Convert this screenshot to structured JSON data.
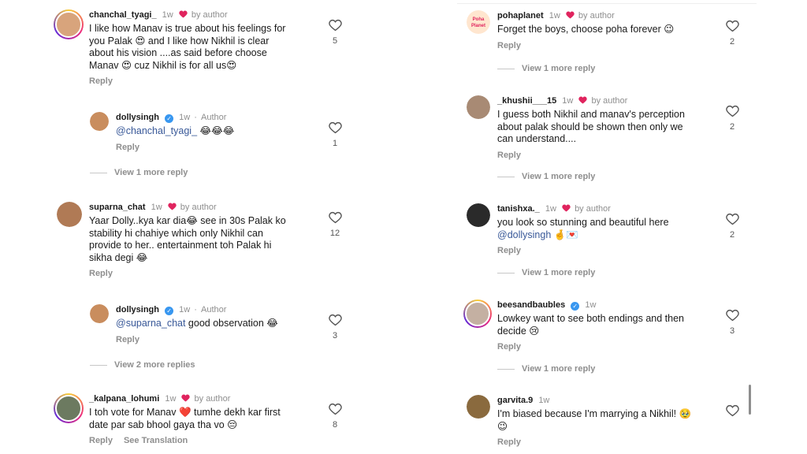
{
  "left": {
    "c1": {
      "username": "chanchal_tyagi_",
      "time": "1w",
      "author_label": "by author",
      "line1": "I like how Manav is true about his feelings for",
      "line2": "you Palak 😍 and I like how Nikhil is clear",
      "line3": "about his vision ....as said before choose",
      "line4": "Manav 😍 cuz Nikhil is for all us😍",
      "reply": "Reply",
      "likes": "5"
    },
    "r1": {
      "username": "dollysingh",
      "time": "1w",
      "author_label": "Author",
      "mention": "@chanchal_tyagi_",
      "rest": " 😂😂😂",
      "reply": "Reply",
      "likes": "1"
    },
    "m1": "View 1 more reply",
    "c2": {
      "username": "suparna_chat",
      "time": "1w",
      "author_label": "by author",
      "line1": "Yaar Dolly..kya kar dia😂 see in 30s Palak ko",
      "line2": "stability hi chahiye which only Nikhil can",
      "line3": "provide to her.. entertainment toh Palak hi",
      "line4": "sikha degi 😂",
      "reply": "Reply",
      "likes": "12"
    },
    "r2": {
      "username": "dollysingh",
      "time": "1w",
      "author_label": "Author",
      "mention": "@suparna_chat",
      "rest": " good observation 😂",
      "reply": "Reply",
      "likes": "3"
    },
    "m2": "View 2 more replies",
    "c3": {
      "username": "_kalpana_lohumi",
      "time": "1w",
      "author_label": "by author",
      "line1": "I toh vote for Manav ❤️ tumhe dekh kar first",
      "line2": "date par sab bhool gaya tha vo 😔",
      "reply": "Reply",
      "translate": "See Translation",
      "likes": "8"
    }
  },
  "right": {
    "c1": {
      "username": "pohaplanet",
      "time": "1w",
      "author_label": "by author",
      "line1": "Forget the boys, choose poha forever 😉",
      "reply": "Reply",
      "likes": "2",
      "avatar_text": "Poha Planet"
    },
    "m1": "View 1 more reply",
    "c2": {
      "username": "_khushii___15",
      "time": "1w",
      "author_label": "by author",
      "line1": "I guess both Nikhil and manav's perception",
      "line2": "about palak should be shown then only we",
      "line3": "can understand....",
      "reply": "Reply",
      "likes": "2"
    },
    "m2": "View 1 more reply",
    "c3": {
      "username": "tanishxa._",
      "time": "1w",
      "author_label": "by author",
      "line1": "you look so stunning and beautiful here",
      "mention": "@dollysingh",
      "rest": " 🤞💌",
      "reply": "Reply",
      "likes": "2"
    },
    "m3": "View 1 more reply",
    "c4": {
      "username": "beesandbaubles",
      "time": "1w",
      "line1": "Lowkey want to see both endings and then",
      "line2": "decide 😢",
      "reply": "Reply",
      "likes": "3"
    },
    "m4": "View 1 more reply",
    "c5": {
      "username": "garvita.9",
      "time": "1w",
      "line1": "I'm biased because I'm marrying a Nikhil! 🥹",
      "line2": "😉",
      "reply": "Reply"
    }
  },
  "colors": {
    "heart_red": "#e0245e",
    "link": "#385898",
    "verified": "#3897f0",
    "muted": "#8e8e8e"
  }
}
